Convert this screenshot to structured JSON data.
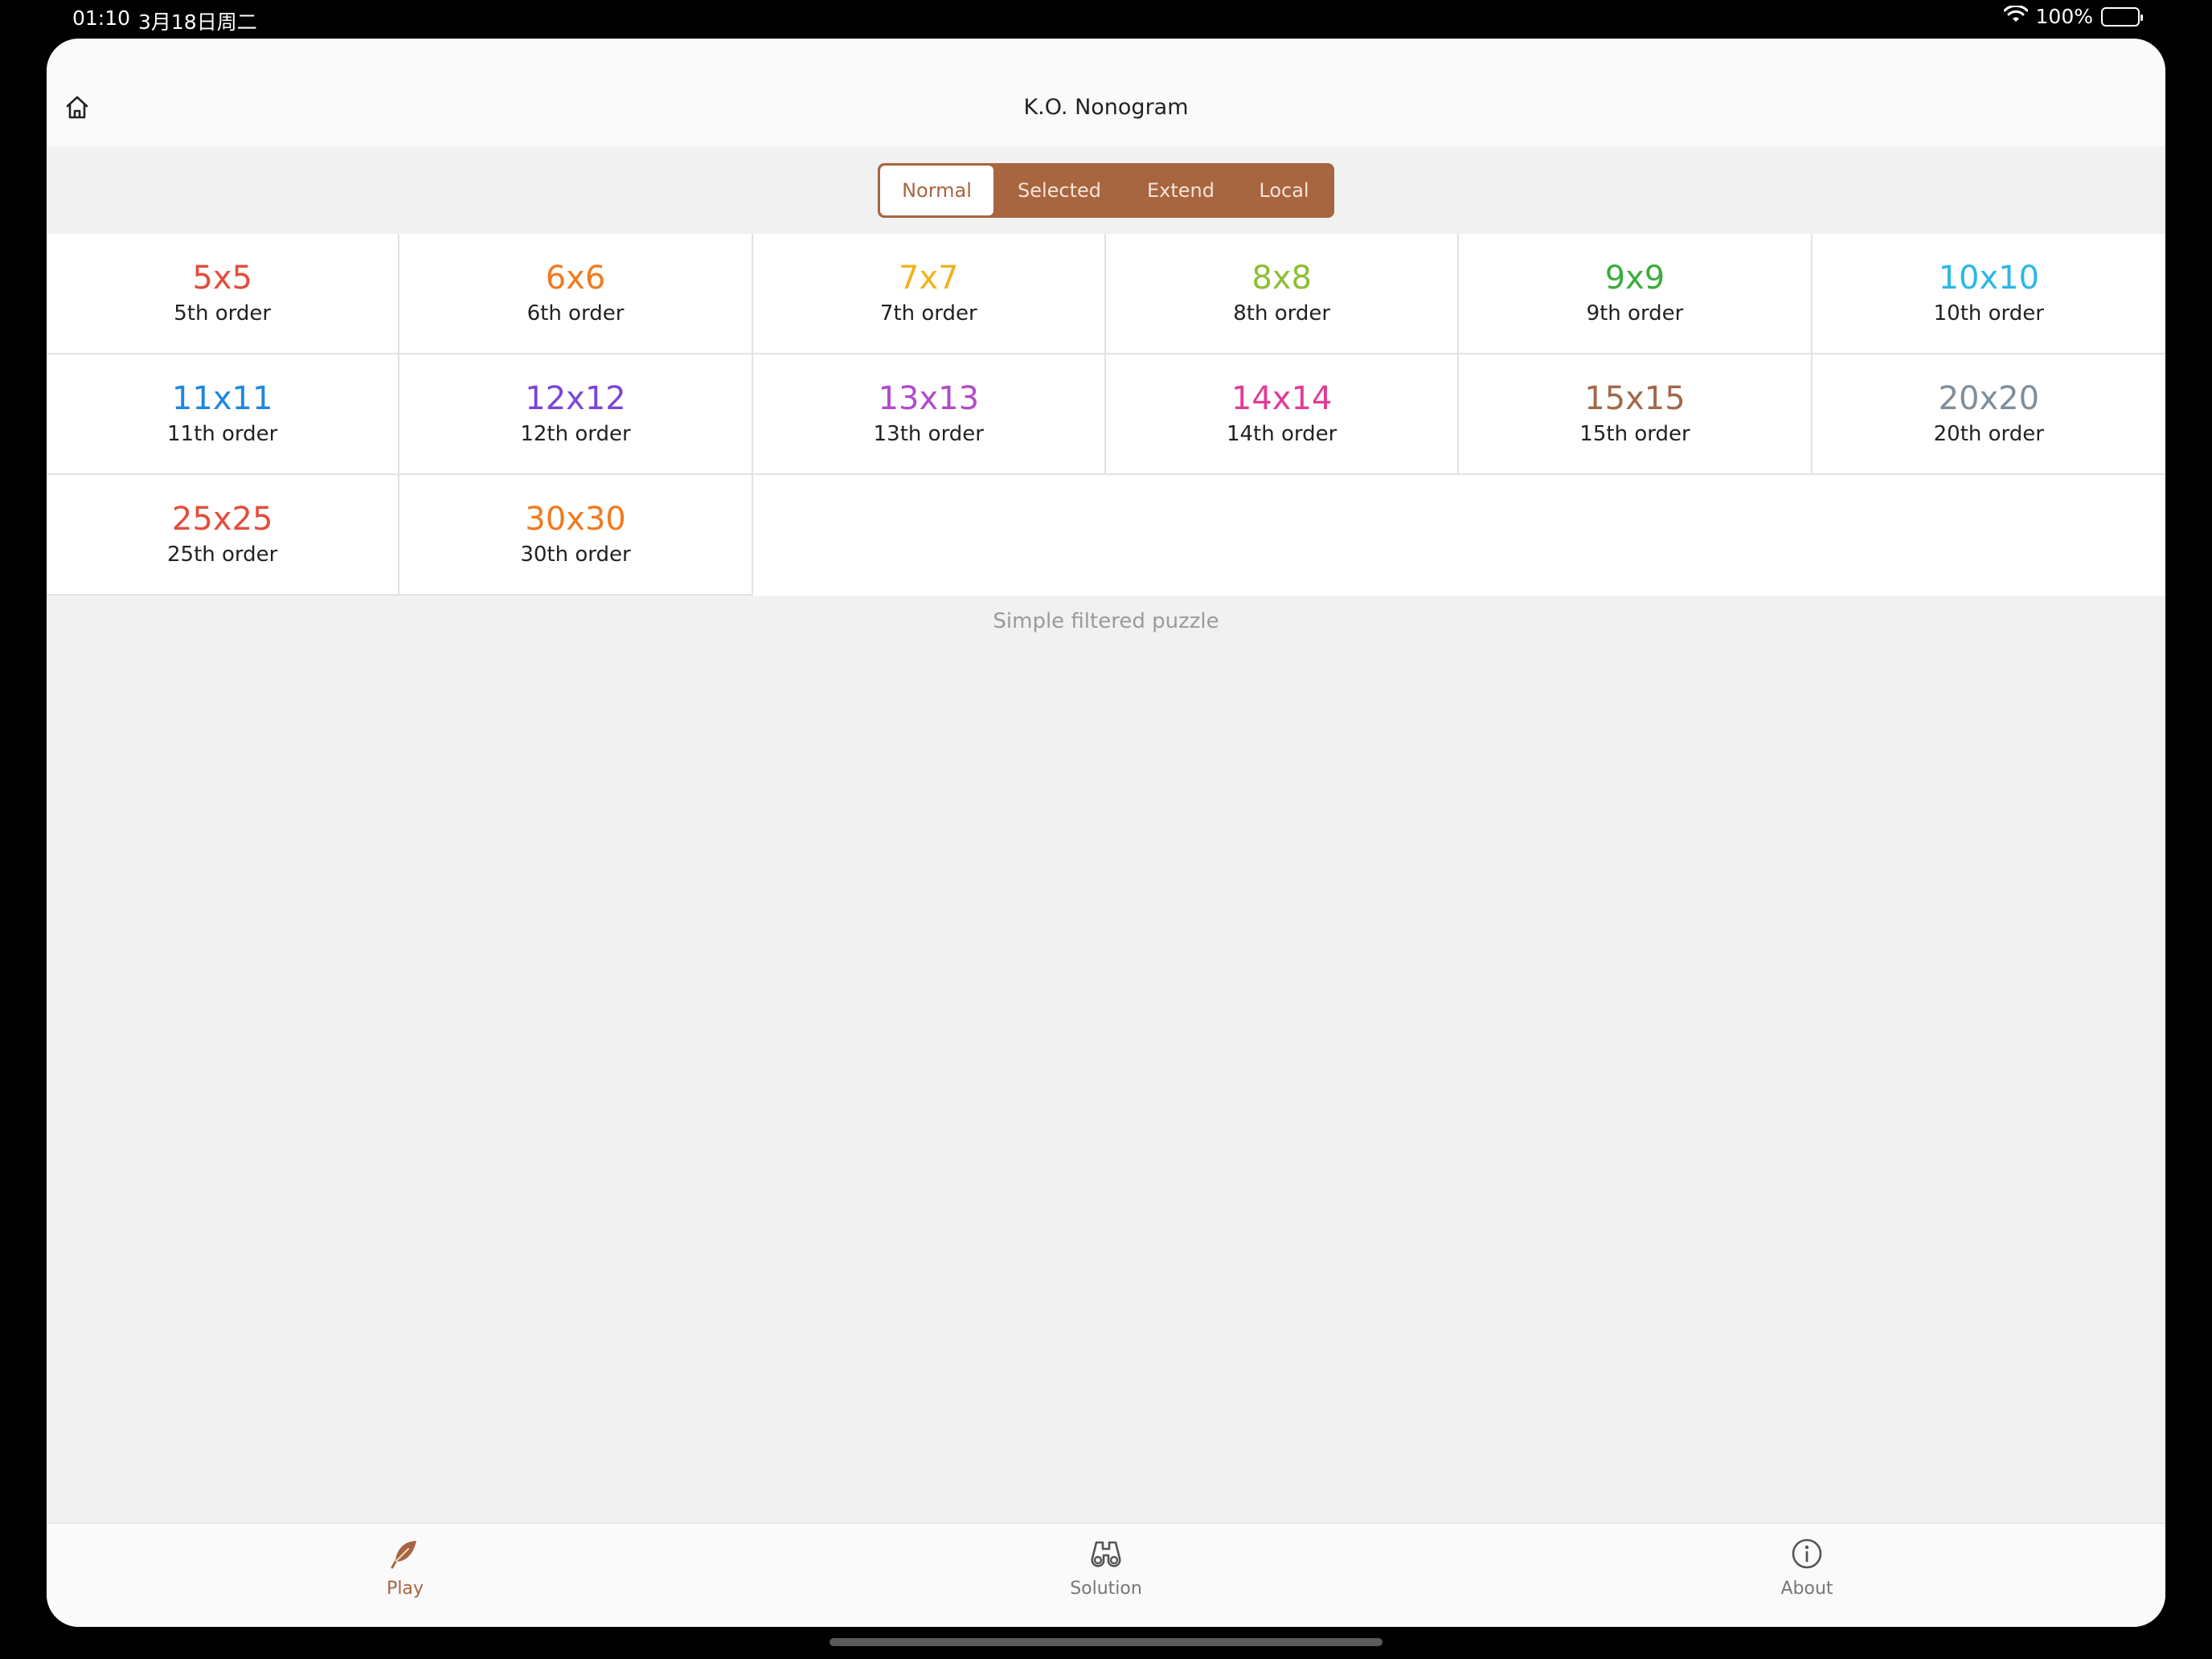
{
  "status": {
    "time": "01:10",
    "date": "3月18日周二",
    "battery": "100%"
  },
  "nav": {
    "title": "K.O. Nonogram"
  },
  "segments": [
    "Normal",
    "Selected",
    "Extend",
    "Local"
  ],
  "grid": [
    {
      "size": "5x5",
      "order": "5th order",
      "color": "#e44d3c"
    },
    {
      "size": "6x6",
      "order": "6th order",
      "color": "#f07a1f"
    },
    {
      "size": "7x7",
      "order": "7th order",
      "color": "#f2b21a"
    },
    {
      "size": "8x8",
      "order": "8th order",
      "color": "#8cbf35"
    },
    {
      "size": "9x9",
      "order": "9th order",
      "color": "#3aad3c"
    },
    {
      "size": "10x10",
      "order": "10th order",
      "color": "#2cb7e6"
    },
    {
      "size": "11x11",
      "order": "11th order",
      "color": "#1f86e0"
    },
    {
      "size": "12x12",
      "order": "12th order",
      "color": "#7a46d6"
    },
    {
      "size": "13x13",
      "order": "13th order",
      "color": "#b24ac9"
    },
    {
      "size": "14x14",
      "order": "14th order",
      "color": "#df3d94"
    },
    {
      "size": "15x15",
      "order": "15th order",
      "color": "#a0694a"
    },
    {
      "size": "20x20",
      "order": "20th order",
      "color": "#7e8e9b"
    },
    {
      "size": "25x25",
      "order": "25th order",
      "color": "#e44d3c"
    },
    {
      "size": "30x30",
      "order": "30th order",
      "color": "#f07a1f"
    }
  ],
  "hint": "Simple filtered puzzle",
  "tabs": [
    {
      "label": "Play",
      "icon": "feather-icon"
    },
    {
      "label": "Solution",
      "icon": "binoculars-icon"
    },
    {
      "label": "About",
      "icon": "info-icon"
    }
  ],
  "colors": {
    "accent": "#a76540"
  }
}
